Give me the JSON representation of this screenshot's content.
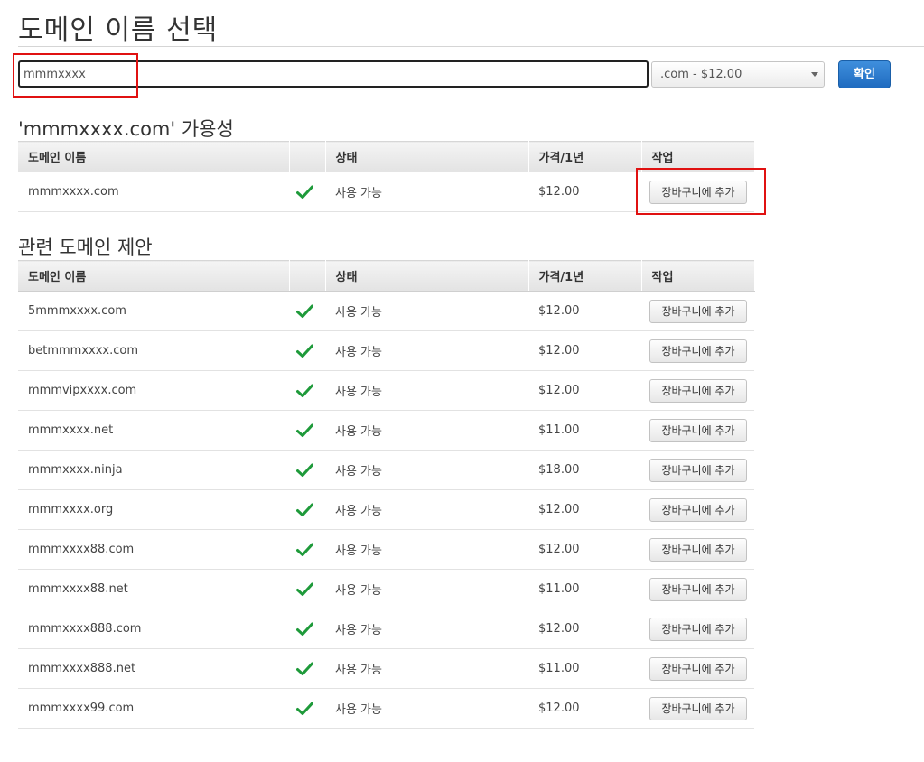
{
  "page": {
    "title": "도메인 이름 선택"
  },
  "search": {
    "value": "mmmxxxx",
    "tld_selected": ".com - $12.00",
    "confirm_label": "확인"
  },
  "availability": {
    "heading": "'mmmxxxx.com' 가용성",
    "columns": [
      "도메인 이름",
      "",
      "상태",
      "가격/1년",
      "작업"
    ],
    "rows": [
      {
        "domain": "mmmxxxx.com",
        "status": "사용 가능",
        "price": "$12.00",
        "action": "장바구니에 추가"
      }
    ]
  },
  "suggestions": {
    "heading": "관련 도메인 제안",
    "columns": [
      "도메인 이름",
      "",
      "상태",
      "가격/1년",
      "작업"
    ],
    "rows": [
      {
        "domain": "5mmmxxxx.com",
        "status": "사용 가능",
        "price": "$12.00",
        "action": "장바구니에 추가"
      },
      {
        "domain": "betmmmxxxx.com",
        "status": "사용 가능",
        "price": "$12.00",
        "action": "장바구니에 추가"
      },
      {
        "domain": "mmmvipxxxx.com",
        "status": "사용 가능",
        "price": "$12.00",
        "action": "장바구니에 추가"
      },
      {
        "domain": "mmmxxxx.net",
        "status": "사용 가능",
        "price": "$11.00",
        "action": "장바구니에 추가"
      },
      {
        "domain": "mmmxxxx.ninja",
        "status": "사용 가능",
        "price": "$18.00",
        "action": "장바구니에 추가"
      },
      {
        "domain": "mmmxxxx.org",
        "status": "사용 가능",
        "price": "$12.00",
        "action": "장바구니에 추가"
      },
      {
        "domain": "mmmxxxx88.com",
        "status": "사용 가능",
        "price": "$12.00",
        "action": "장바구니에 추가"
      },
      {
        "domain": "mmmxxxx88.net",
        "status": "사용 가능",
        "price": "$11.00",
        "action": "장바구니에 추가"
      },
      {
        "domain": "mmmxxxx888.com",
        "status": "사용 가능",
        "price": "$12.00",
        "action": "장바구니에 추가"
      },
      {
        "domain": "mmmxxxx888.net",
        "status": "사용 가능",
        "price": "$11.00",
        "action": "장바구니에 추가"
      },
      {
        "domain": "mmmxxxx99.com",
        "status": "사용 가능",
        "price": "$12.00",
        "action": "장바구니에 추가"
      }
    ]
  },
  "icons": {
    "available": "check-icon"
  },
  "colors": {
    "check": "#1e9a3a",
    "highlight": "#e01111",
    "primary_button": "#1f6bc0"
  }
}
